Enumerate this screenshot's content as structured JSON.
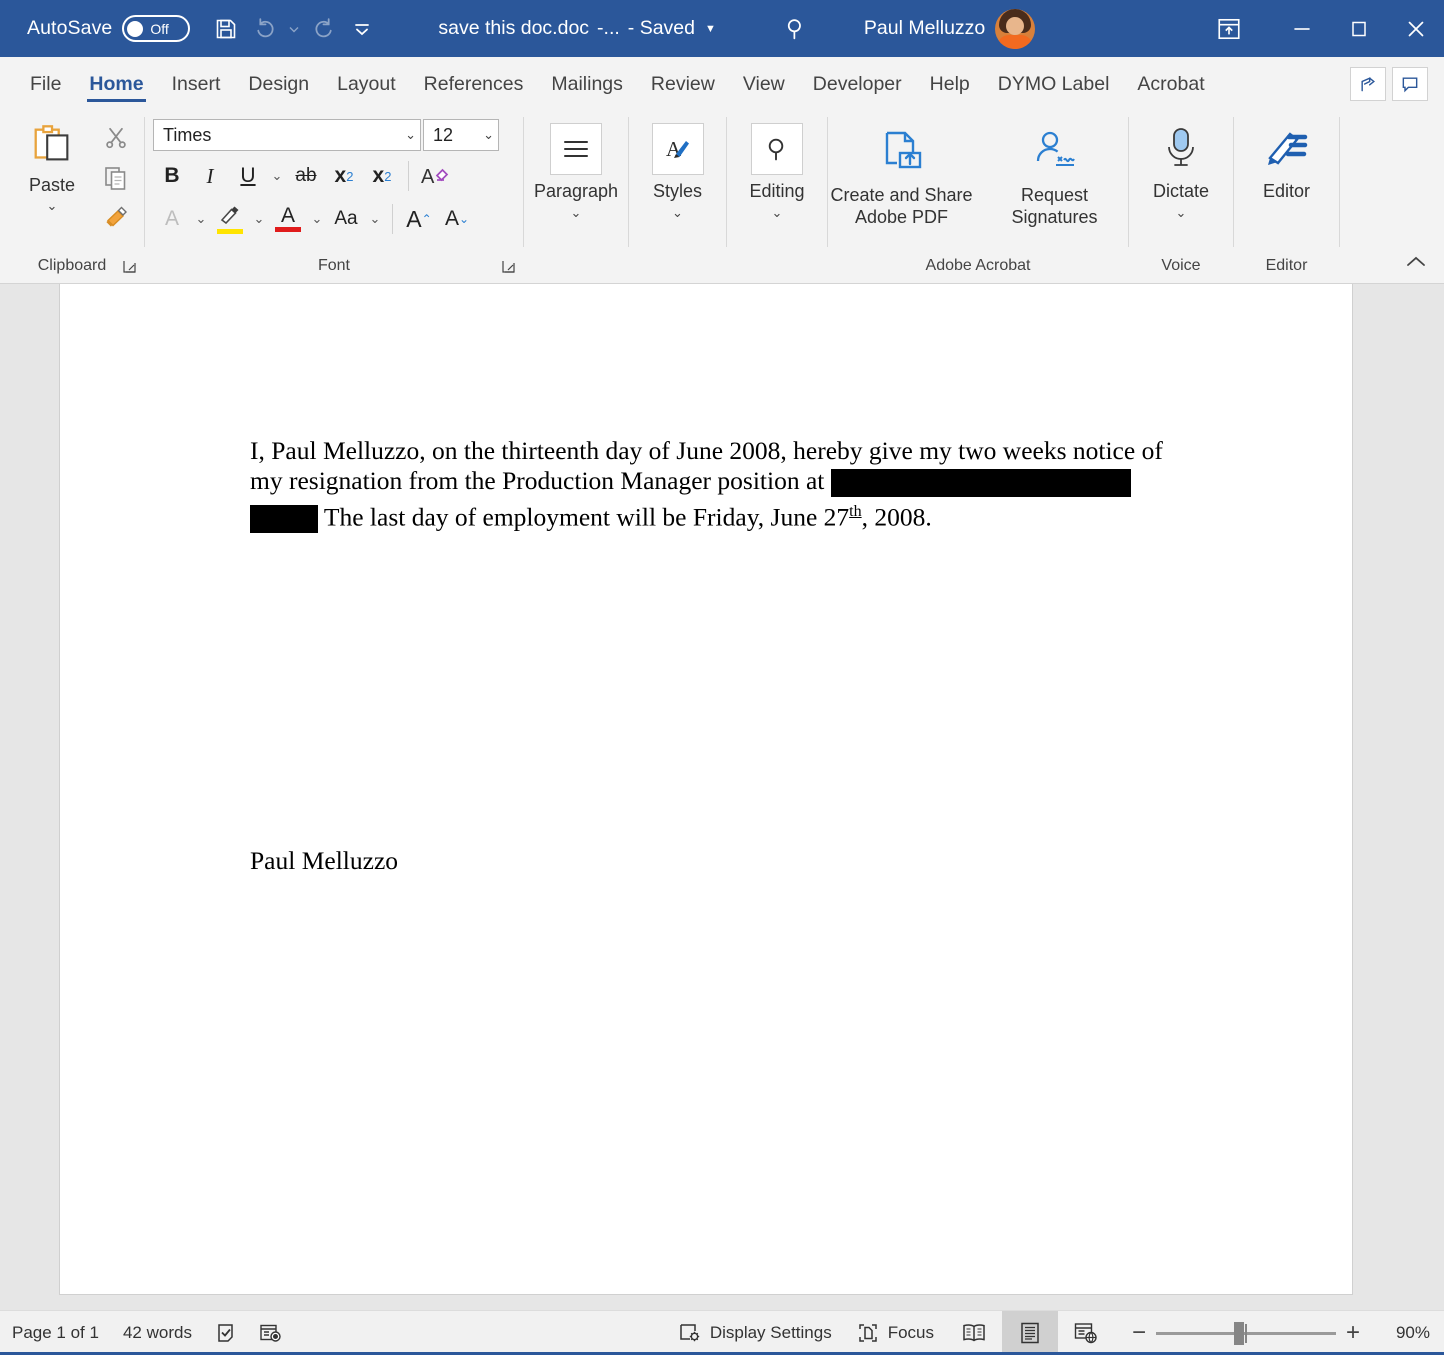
{
  "titlebar": {
    "autosave_label": "AutoSave",
    "autosave_state": "Off",
    "document_name": "save this doc.doc",
    "document_suffix": "-...",
    "saved_status": "- Saved",
    "account_name": "Paul Melluzzo",
    "save_icon": "save-icon",
    "undo_icon": "undo-icon",
    "redo_icon": "redo-icon",
    "customize_qat_icon": "customize-quick-access-toolbar-icon",
    "search_icon": "search-icon",
    "ribbon_display_icon": "ribbon-display-options-icon",
    "minimize_icon": "minimize-icon",
    "maximize_icon": "maximize-icon",
    "close_icon": "close-icon"
  },
  "tabs": [
    {
      "label": "File",
      "active": false
    },
    {
      "label": "Home",
      "active": true
    },
    {
      "label": "Insert",
      "active": false
    },
    {
      "label": "Design",
      "active": false
    },
    {
      "label": "Layout",
      "active": false
    },
    {
      "label": "References",
      "active": false
    },
    {
      "label": "Mailings",
      "active": false
    },
    {
      "label": "Review",
      "active": false
    },
    {
      "label": "View",
      "active": false
    },
    {
      "label": "Developer",
      "active": false
    },
    {
      "label": "Help",
      "active": false
    },
    {
      "label": "DYMO Label",
      "active": false
    },
    {
      "label": "Acrobat",
      "active": false
    }
  ],
  "tabbar_right": {
    "share_icon": "share-icon",
    "comments_icon": "comments-icon"
  },
  "ribbon": {
    "clipboard": {
      "group_label": "Clipboard",
      "paste_label": "Paste",
      "cut_icon": "cut-scissors-icon",
      "copy_icon": "copy-icon",
      "format_painter_icon": "format-painter-icon",
      "dialog_launcher": "dialog-box-launcher-icon"
    },
    "font": {
      "group_label": "Font",
      "font_name": "Times",
      "font_size": "12",
      "bold_label": "B",
      "italic_label": "I",
      "underline_label": "U",
      "strikethrough_label": "ab",
      "subscript_label": "x",
      "subscript_sub": "2",
      "superscript_label": "x",
      "superscript_sup": "2",
      "clear_formatting_icon": "clear-all-formatting-icon",
      "text_effects_label": "A",
      "highlight_label": "pen",
      "highlight_color": "#ffe400",
      "font_color_label": "A",
      "font_color": "#e01b1b",
      "change_case_label": "Aa",
      "grow_font_label": "A",
      "shrink_font_label": "A",
      "dialog_launcher": "dialog-box-launcher-icon"
    },
    "paragraph": {
      "group_label": "Paragraph",
      "icon": "paragraph-lines-icon"
    },
    "styles": {
      "group_label": "Styles",
      "icon": "styles-pen-icon"
    },
    "editing": {
      "group_label": "Editing",
      "icon": "find-magnifier-icon"
    },
    "acrobat": {
      "group_label": "Adobe Acrobat",
      "create_share_label": "Create and Share\nAdobe PDF",
      "create_share_line1": "Create and Share",
      "create_share_line2": "Adobe PDF",
      "create_share_icon": "pdf-upload-icon",
      "request_sig_line1": "Request",
      "request_sig_line2": "Signatures",
      "request_sig_icon": "request-signatures-icon"
    },
    "voice": {
      "group_label": "Voice",
      "dictate_label": "Dictate",
      "icon": "microphone-icon"
    },
    "editor": {
      "group_label": "Editor",
      "editor_label": "Editor",
      "icon": "editor-pen-icon"
    },
    "collapse_icon": "collapse-ribbon-chevron-up-icon"
  },
  "document": {
    "paragraph_part1": "I, Paul Melluzzo, on the thirteenth day of June 2008, hereby give my two weeks notice of my resignation from the Production Manager position at ",
    "paragraph_part2": " The last day of employment will be Friday, June 27",
    "paragraph_superscript": "th",
    "paragraph_part3": ", 2008.",
    "redaction_1": "redacted-black-bar",
    "redaction_2": "redacted-black-bar",
    "signature": "Paul Melluzzo"
  },
  "statusbar": {
    "page_status": "Page 1 of 1",
    "word_count": "42 words",
    "proofing_icon": "proofing-check-icon",
    "accessibility_icon": "accessibility-checker-icon",
    "display_settings_label": "Display Settings",
    "display_settings_icon": "display-settings-icon",
    "focus_label": "Focus",
    "focus_icon": "focus-mode-icon",
    "read_mode_icon": "read-mode-icon",
    "print_layout_icon": "print-layout-icon",
    "web_layout_icon": "web-layout-icon",
    "zoom_out_label": "−",
    "zoom_in_label": "+",
    "zoom_percent": "90%"
  },
  "colors": {
    "titlebar_blue": "#2b579a",
    "ribbon_gray": "#f3f3f3",
    "doc_background": "#e6e6e6",
    "accent": "#2b579a"
  }
}
